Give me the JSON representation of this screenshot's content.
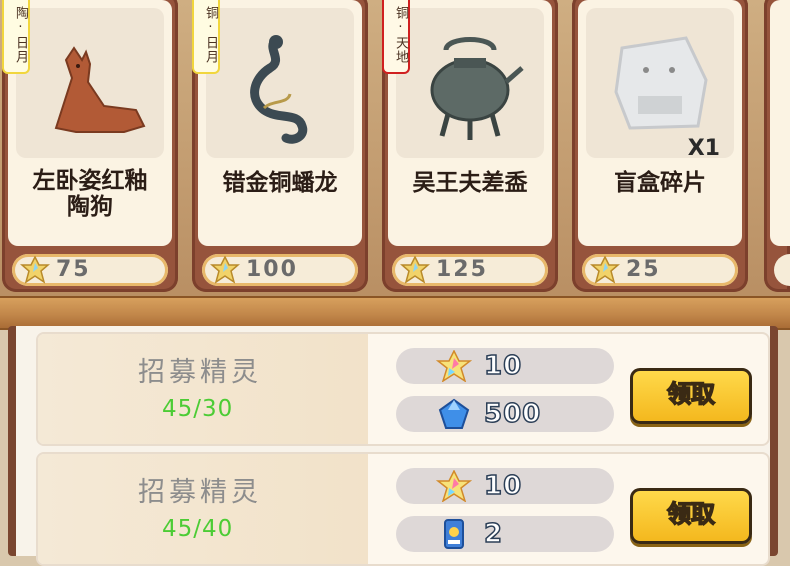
{
  "shop_items": [
    {
      "tag": "陶·日月",
      "tag_style": "yellow",
      "name": "左卧姿红釉陶狗",
      "name_two_line": true,
      "name_line1": "左卧姿红釉",
      "name_line2": "陶狗",
      "price": "75",
      "qty": ""
    },
    {
      "tag": "铜·日月",
      "tag_style": "yellow",
      "name": "错金铜蟠龙",
      "name_two_line": false,
      "price": "100",
      "qty": ""
    },
    {
      "tag": "铜·天地",
      "tag_style": "red",
      "name": "吴王夫差盉",
      "name_two_line": false,
      "price": "125",
      "qty": ""
    },
    {
      "tag": "",
      "tag_style": "",
      "name": "盲盒碎片",
      "name_two_line": false,
      "price": "25",
      "qty": "X1"
    }
  ],
  "tasks": [
    {
      "title": "招募精灵",
      "progress": "45/30",
      "costs": [
        {
          "icon": "star-crystal-icon",
          "amount": "10"
        },
        {
          "icon": "blue-gem-icon",
          "amount": "500"
        }
      ],
      "button": "领取"
    },
    {
      "title": "招募精灵",
      "progress": "45/40",
      "costs": [
        {
          "icon": "star-crystal-icon",
          "amount": "10"
        },
        {
          "icon": "ticket-icon",
          "amount": "2"
        }
      ],
      "button": "领取"
    }
  ],
  "colors": {
    "progress_green": "#4ccc35",
    "button_yellow": "#f4b81e",
    "card_frame": "#96543c",
    "tag_red": "#d02020",
    "tag_yellow": "#f1d63d"
  }
}
